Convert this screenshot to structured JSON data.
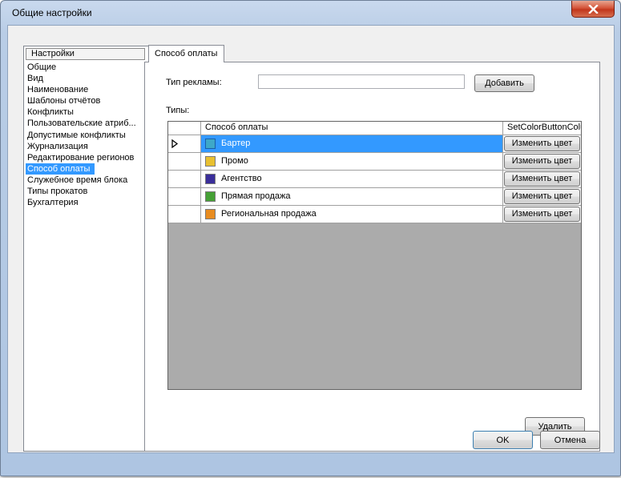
{
  "window": {
    "title": "Общие настройки"
  },
  "sidebar": {
    "header": "Настройки",
    "items": [
      {
        "label": "Общие"
      },
      {
        "label": "Вид"
      },
      {
        "label": "Наименование"
      },
      {
        "label": "Шаблоны отчётов"
      },
      {
        "label": "Конфликты"
      },
      {
        "label": "Пользовательские атриб..."
      },
      {
        "label": "Допустимые конфликты"
      },
      {
        "label": "Журнализация"
      },
      {
        "label": "Редактирование регионов"
      },
      {
        "label": "Способ оплаты"
      },
      {
        "label": "Служебное время блока"
      },
      {
        "label": "Типы прокатов"
      },
      {
        "label": "Бухгалтерия"
      }
    ],
    "selected_label": "Способ оплаты"
  },
  "tab": {
    "label": "Способ оплаты"
  },
  "form": {
    "ad_type_label": "Тип рекламы:",
    "ad_type_value": "",
    "add_button": "Добавить",
    "types_label": "Типы:",
    "delete_button": "Удалить"
  },
  "grid": {
    "columns": [
      "",
      "Способ оплаты",
      "SetColorButtonColu"
    ],
    "rows": [
      {
        "name": "Бартер",
        "color": "#3ea8c8",
        "button": "Изменить цвет",
        "selected": true
      },
      {
        "name": "Промо",
        "color": "#e8c030",
        "button": "Изменить цвет",
        "selected": false
      },
      {
        "name": "Агентство",
        "color": "#3a2e9a",
        "button": "Изменить цвет",
        "selected": false
      },
      {
        "name": "Прямая продажа",
        "color": "#45a035",
        "button": "Изменить цвет",
        "selected": false
      },
      {
        "name": "Региональная продажа",
        "color": "#e88c20",
        "button": "Изменить цвет",
        "selected": false
      }
    ]
  },
  "footer": {
    "ok_button": "OK",
    "cancel_button": "Отмена"
  },
  "icons": {
    "close": "close-icon",
    "row_pointer": "row-pointer-icon"
  }
}
